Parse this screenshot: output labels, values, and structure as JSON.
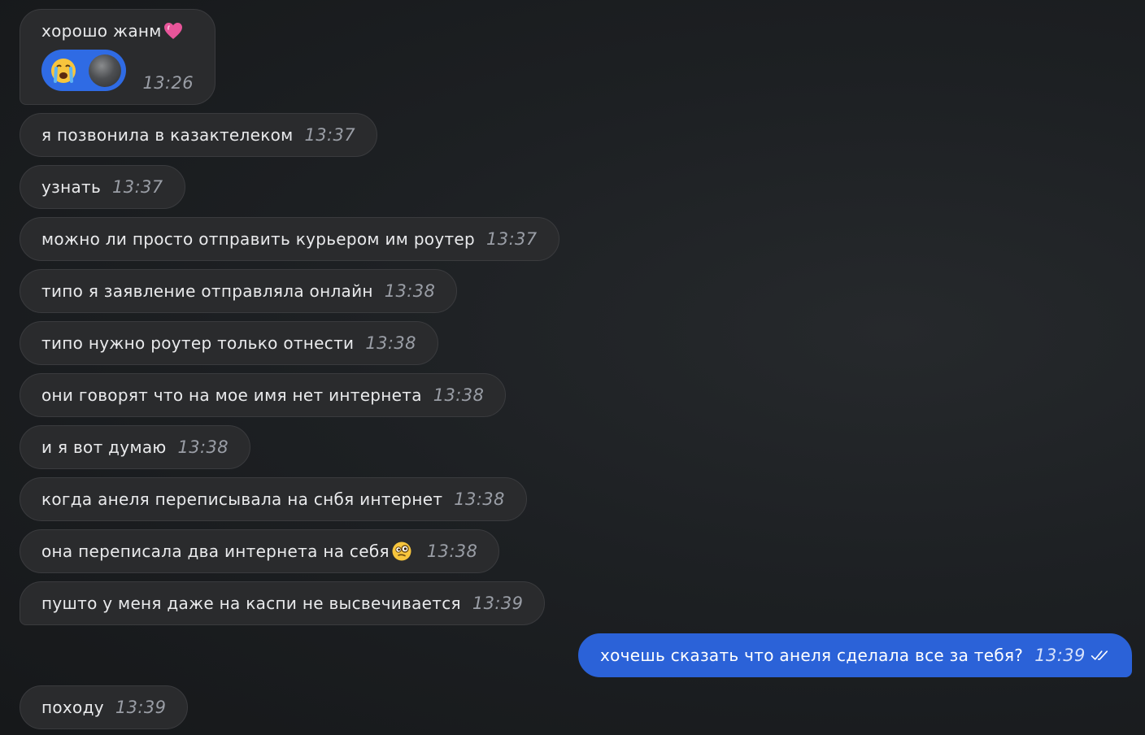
{
  "messages": [
    {
      "text": "хорошо жанм",
      "time": "13:26"
    },
    {
      "text": "я позвонила в казактелеком",
      "time": "13:37"
    },
    {
      "text": "узнать",
      "time": "13:37"
    },
    {
      "text": "можно ли просто отправить курьером им роутер",
      "time": "13:37"
    },
    {
      "text": "типо я заявление отправляла онлайн",
      "time": "13:38"
    },
    {
      "text": "типо нужно роутер только отнести",
      "time": "13:38"
    },
    {
      "text": "они говорят что на мое имя нет интернета",
      "time": "13:38"
    },
    {
      "text": "и я вот думаю",
      "time": "13:38"
    },
    {
      "text": "когда анеля переписывала на снбя интернет",
      "time": "13:38"
    },
    {
      "text": "она переписала два интернета на себя",
      "time": "13:38"
    },
    {
      "text": "пушто у меня даже на каспи не высвечивается",
      "time": "13:39"
    },
    {
      "text": "хочешь сказать что анеля сделала все за тебя?",
      "time": "13:39"
    },
    {
      "text": "походу",
      "time": "13:39"
    }
  ],
  "reaction": {
    "emoji": "😭"
  },
  "colors": {
    "incoming_bubble": "#2a2b2d",
    "outgoing_bubble": "#2b62d8",
    "reaction_bg": "#2f6be4",
    "time_text": "#9a9ea6"
  },
  "icons": [
    "heart-emoji-icon",
    "crying-face-emoji-icon",
    "reactor-avatar",
    "thinking-face-emoji-icon",
    "double-check-read-icon"
  ]
}
